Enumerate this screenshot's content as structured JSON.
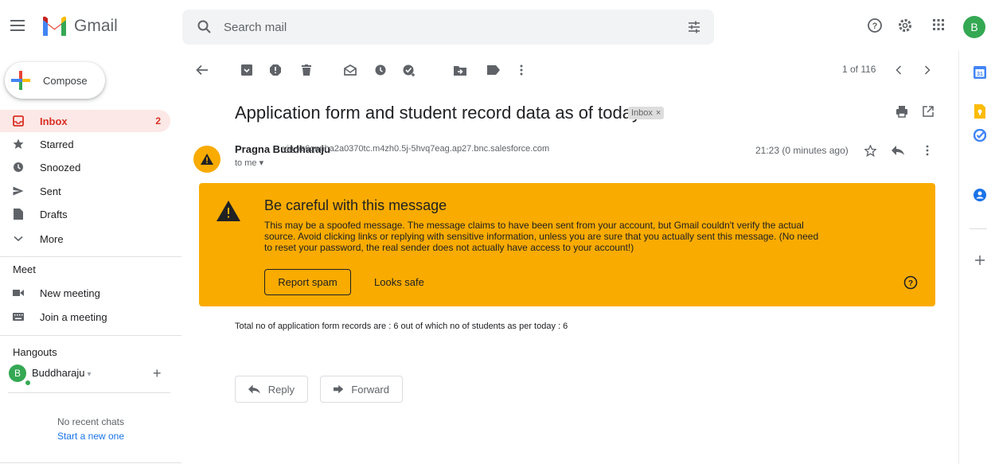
{
  "header": {
    "app_name": "Gmail",
    "search_placeholder": "Search mail",
    "avatar_letter": "B",
    "icons": [
      "menu-icon",
      "search-icon",
      "tune-icon",
      "help-icon",
      "settings-icon",
      "apps-icon"
    ]
  },
  "sidebar": {
    "compose_label": "Compose",
    "items": [
      {
        "label": "Inbox",
        "count": "2",
        "icon": "inbox-icon",
        "active": true
      },
      {
        "label": "Starred",
        "icon": "star-icon"
      },
      {
        "label": "Snoozed",
        "icon": "clock-icon"
      },
      {
        "label": "Sent",
        "icon": "send-icon"
      },
      {
        "label": "Drafts",
        "icon": "draft-icon"
      },
      {
        "label": "More",
        "icon": "chevron-down-icon"
      }
    ],
    "meet": {
      "title": "Meet",
      "new_meeting": "New meeting",
      "join_meeting": "Join a meeting"
    },
    "hangouts": {
      "title": "Hangouts",
      "user": "Buddharaju",
      "avatar_letter": "B",
      "no_chats": "No recent chats",
      "start_new": "Start a new one"
    }
  },
  "toolbar": {
    "pager": "1 of 116",
    "icons": [
      "back-arrow-icon",
      "archive-icon",
      "report-spam-icon",
      "delete-icon",
      "mark-unread-icon",
      "snooze-icon",
      "add-task-icon",
      "move-to-icon",
      "label-icon",
      "more-icon"
    ]
  },
  "message": {
    "subject": "Application form and student record data as of today",
    "label_chip": "Inbox",
    "label_chip_close": "×",
    "sender_name": "Pragna Buddharaju",
    "via_prefix": "via",
    "via_domain": "yz6qnnha2a0370tc.m4zh0.5j-5hvq7eag.ap27.bnc.salesforce.com",
    "to": "to me",
    "time": "21:23 (0 minutes ago)",
    "body": "Total no of application form records are : 6 out of which no of students as per today : 6"
  },
  "warning": {
    "title": "Be careful with this message",
    "body": "This may be a spoofed message. The message claims to have been sent from your account, but Gmail couldn't verify the actual source. Avoid clicking links or replying with sensitive information, unless you are sure that you actually sent this message. (No need to reset your password, the real sender does not actually have access to your account!)",
    "report_label": "Report spam",
    "safe_label": "Looks safe",
    "color": "#f9ab00"
  },
  "actions": {
    "reply_label": "Reply",
    "forward_label": "Forward"
  },
  "colors": {
    "accent_red": "#d93025",
    "inbox_highlight": "#fce8e6",
    "link_blue": "#1a73e8",
    "avatar_green": "#34a853"
  }
}
